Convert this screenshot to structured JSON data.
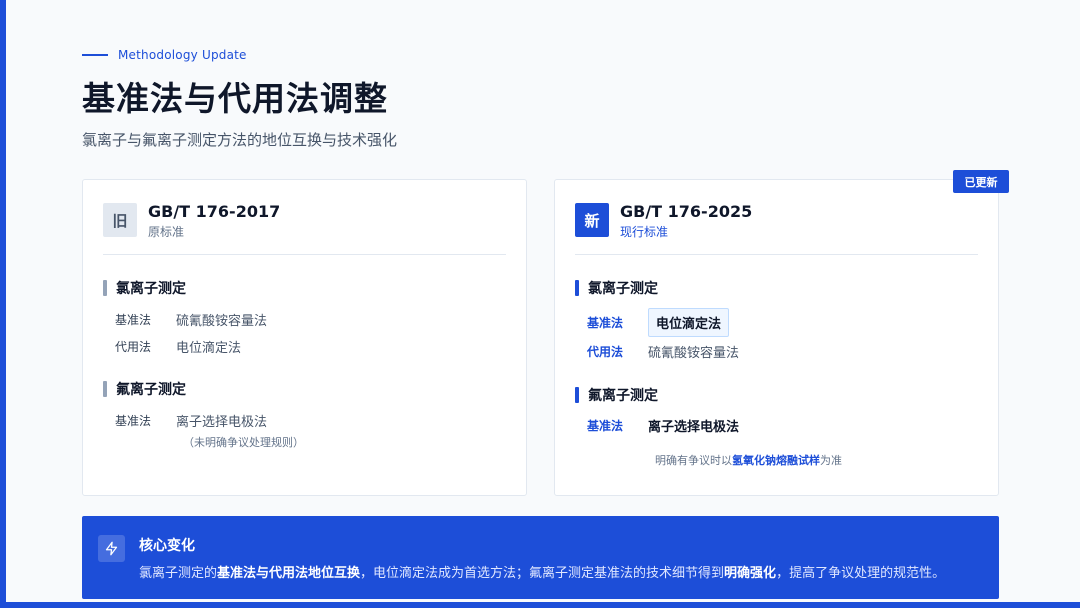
{
  "header": {
    "eyebrow": "Methodology Update",
    "title": "基准法与代用法调整",
    "subtitle": "氯离子与氟离子测定方法的地位互换与技术强化"
  },
  "badge": {
    "updated": "已更新"
  },
  "old_card": {
    "tag": "旧",
    "code": "GB/T 176-2017",
    "desc": "原标准",
    "chloride": {
      "title": "氯离子测定",
      "rows": [
        {
          "label": "基准法",
          "value": "硫氰酸铵容量法"
        },
        {
          "label": "代用法",
          "value": "电位滴定法"
        }
      ]
    },
    "fluoride": {
      "title": "氟离子测定",
      "rows": [
        {
          "label": "基准法",
          "value": "离子选择电极法"
        }
      ],
      "note": "（未明确争议处理规则）"
    }
  },
  "new_card": {
    "tag": "新",
    "code": "GB/T 176-2025",
    "desc": "现行标准",
    "chloride": {
      "title": "氯离子测定",
      "rows": [
        {
          "label": "基准法",
          "value": "电位滴定法"
        },
        {
          "label": "代用法",
          "value": "硫氰酸铵容量法"
        }
      ]
    },
    "fluoride": {
      "title": "氟离子测定",
      "rows": [
        {
          "label": "基准法",
          "value": "离子选择电极法"
        }
      ],
      "note_pre": "明确有争议时以",
      "note_hl": "氢氧化钠熔融试样",
      "note_post": "为准"
    }
  },
  "summary": {
    "icon": "lightning-icon",
    "title": "核心变化",
    "t1": "氯离子测定的",
    "b1": "基准法与代用法地位互换",
    "t2": "，电位滴定法成为首选方法；氟离子测定基准法的技术细节得到",
    "b2": "明确强化",
    "t3": "，提高了争议处理的规范性。"
  },
  "colors": {
    "accent": "#1d4ed8",
    "background": "#f8fafc"
  }
}
